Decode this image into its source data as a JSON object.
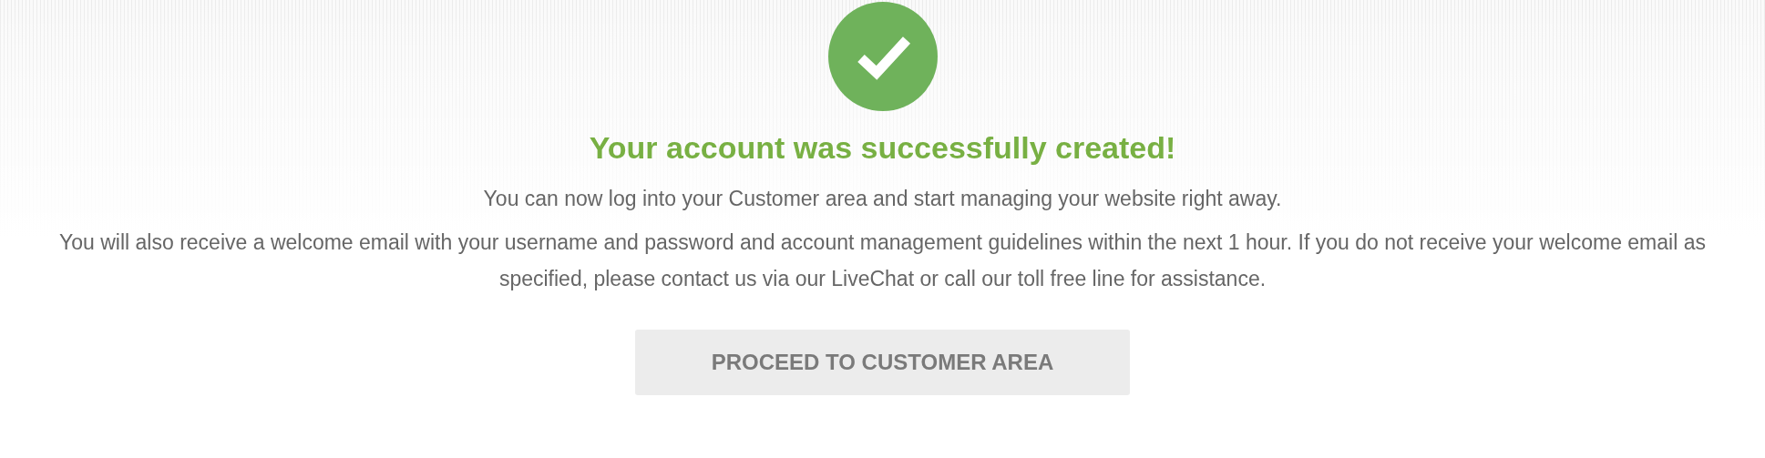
{
  "success": {
    "title": "Your account was successfully created!",
    "message": "You can now log into your Customer area and start managing your website right away.",
    "note": "You will also receive a welcome email with your username and password and account management guidelines within the next 1 hour. If you do not receive your welcome email as specified, please contact us via our LiveChat or call our toll free line for assistance.",
    "button": "PROCEED TO CUSTOMER AREA"
  }
}
